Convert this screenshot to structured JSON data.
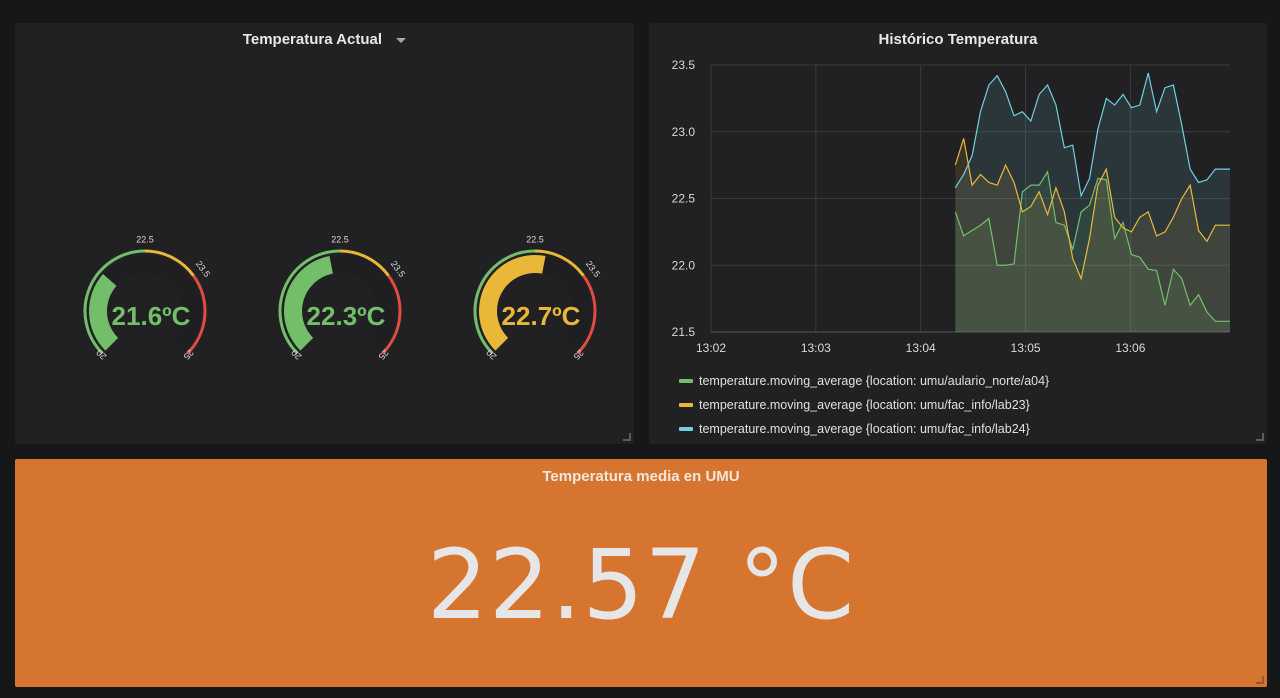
{
  "gauge_panel": {
    "title": "Temperatura Actual",
    "gauges": [
      {
        "value": 21.6,
        "display": "21.6ºC",
        "color": "#73bf69"
      },
      {
        "value": 22.3,
        "display": "22.3ºC",
        "color": "#73bf69"
      },
      {
        "value": 22.7,
        "display": "22.7ºC",
        "color": "#eab839"
      }
    ],
    "min_label": "20",
    "max_label": "25",
    "thresholds": [
      {
        "label": "22.5",
        "value": 22.5
      },
      {
        "label": "23.5",
        "value": 23.5
      }
    ],
    "min": 20,
    "max": 25,
    "threshold_colors": [
      "#73bf69",
      "#eab839",
      "#e24d42"
    ]
  },
  "graph_panel": {
    "title": "Histórico Temperatura"
  },
  "chart_data": {
    "type": "line",
    "x_ticks": [
      "13:02",
      "13:03",
      "13:04",
      "13:05",
      "13:06"
    ],
    "y_ticks": [
      "23.5",
      "23.0",
      "22.5",
      "22.0",
      "21.5"
    ],
    "xlim": [
      1.0,
      5.95
    ],
    "ylim": [
      21.5,
      23.5
    ],
    "grid": true,
    "legend_position": "bottom",
    "series": [
      {
        "name": "temperature.moving_average {location: umu/aulario_norte/a04}",
        "color": "#73bf69",
        "x": [
          3.33,
          3.41,
          3.49,
          3.57,
          3.65,
          3.73,
          3.81,
          3.89,
          3.97,
          4.05,
          4.13,
          4.21,
          4.29,
          4.37,
          4.45,
          4.53,
          4.61,
          4.69,
          4.77,
          4.85,
          4.93,
          5.01,
          5.09,
          5.17,
          5.25,
          5.33,
          5.41,
          5.49,
          5.57,
          5.65,
          5.73,
          5.81,
          5.89,
          5.95
        ],
        "y": [
          22.4,
          22.22,
          22.26,
          22.3,
          22.35,
          22.0,
          22.0,
          22.01,
          22.55,
          22.6,
          22.6,
          22.7,
          22.32,
          22.3,
          22.12,
          22.4,
          22.45,
          22.65,
          22.64,
          22.2,
          22.32,
          22.08,
          22.06,
          21.97,
          21.96,
          21.7,
          21.97,
          21.9,
          21.7,
          21.78,
          21.65,
          21.58,
          21.58,
          21.58
        ],
        "fill": true
      },
      {
        "name": "temperature.moving_average {location: umu/fac_info/lab23}",
        "color": "#eab839",
        "x": [
          3.33,
          3.41,
          3.49,
          3.57,
          3.65,
          3.73,
          3.81,
          3.89,
          3.97,
          4.05,
          4.13,
          4.21,
          4.29,
          4.37,
          4.45,
          4.53,
          4.61,
          4.69,
          4.77,
          4.85,
          4.93,
          5.01,
          5.09,
          5.17,
          5.25,
          5.33,
          5.41,
          5.49,
          5.57,
          5.65,
          5.73,
          5.81,
          5.89,
          5.95
        ],
        "y": [
          22.75,
          22.95,
          22.6,
          22.68,
          22.62,
          22.6,
          22.75,
          22.62,
          22.4,
          22.44,
          22.55,
          22.38,
          22.58,
          22.4,
          22.05,
          21.9,
          22.2,
          22.6,
          22.72,
          22.36,
          22.28,
          22.25,
          22.36,
          22.4,
          22.22,
          22.25,
          22.36,
          22.5,
          22.6,
          22.26,
          22.18,
          22.3,
          22.3,
          22.3
        ],
        "fill": true
      },
      {
        "name": "temperature.moving_average {location: umu/fac_info/lab24}",
        "color": "#6ed0e0",
        "x": [
          3.33,
          3.41,
          3.49,
          3.57,
          3.65,
          3.73,
          3.81,
          3.89,
          3.97,
          4.05,
          4.13,
          4.21,
          4.29,
          4.37,
          4.45,
          4.53,
          4.61,
          4.69,
          4.77,
          4.85,
          4.93,
          5.01,
          5.09,
          5.17,
          5.25,
          5.33,
          5.41,
          5.49,
          5.57,
          5.65,
          5.73,
          5.81,
          5.89,
          5.95
        ],
        "y": [
          22.58,
          22.68,
          22.82,
          23.15,
          23.35,
          23.42,
          23.3,
          23.12,
          23.15,
          23.08,
          23.28,
          23.35,
          23.2,
          22.88,
          22.9,
          22.52,
          22.65,
          23.02,
          23.25,
          23.2,
          23.28,
          23.18,
          23.2,
          23.44,
          23.15,
          23.33,
          23.35,
          23.05,
          22.72,
          22.62,
          22.64,
          22.72,
          22.72,
          22.72
        ],
        "fill": true
      }
    ]
  },
  "stat_panel": {
    "title": "Temperatura media en UMU",
    "value": "22.57 °C",
    "background": "#d67530"
  }
}
